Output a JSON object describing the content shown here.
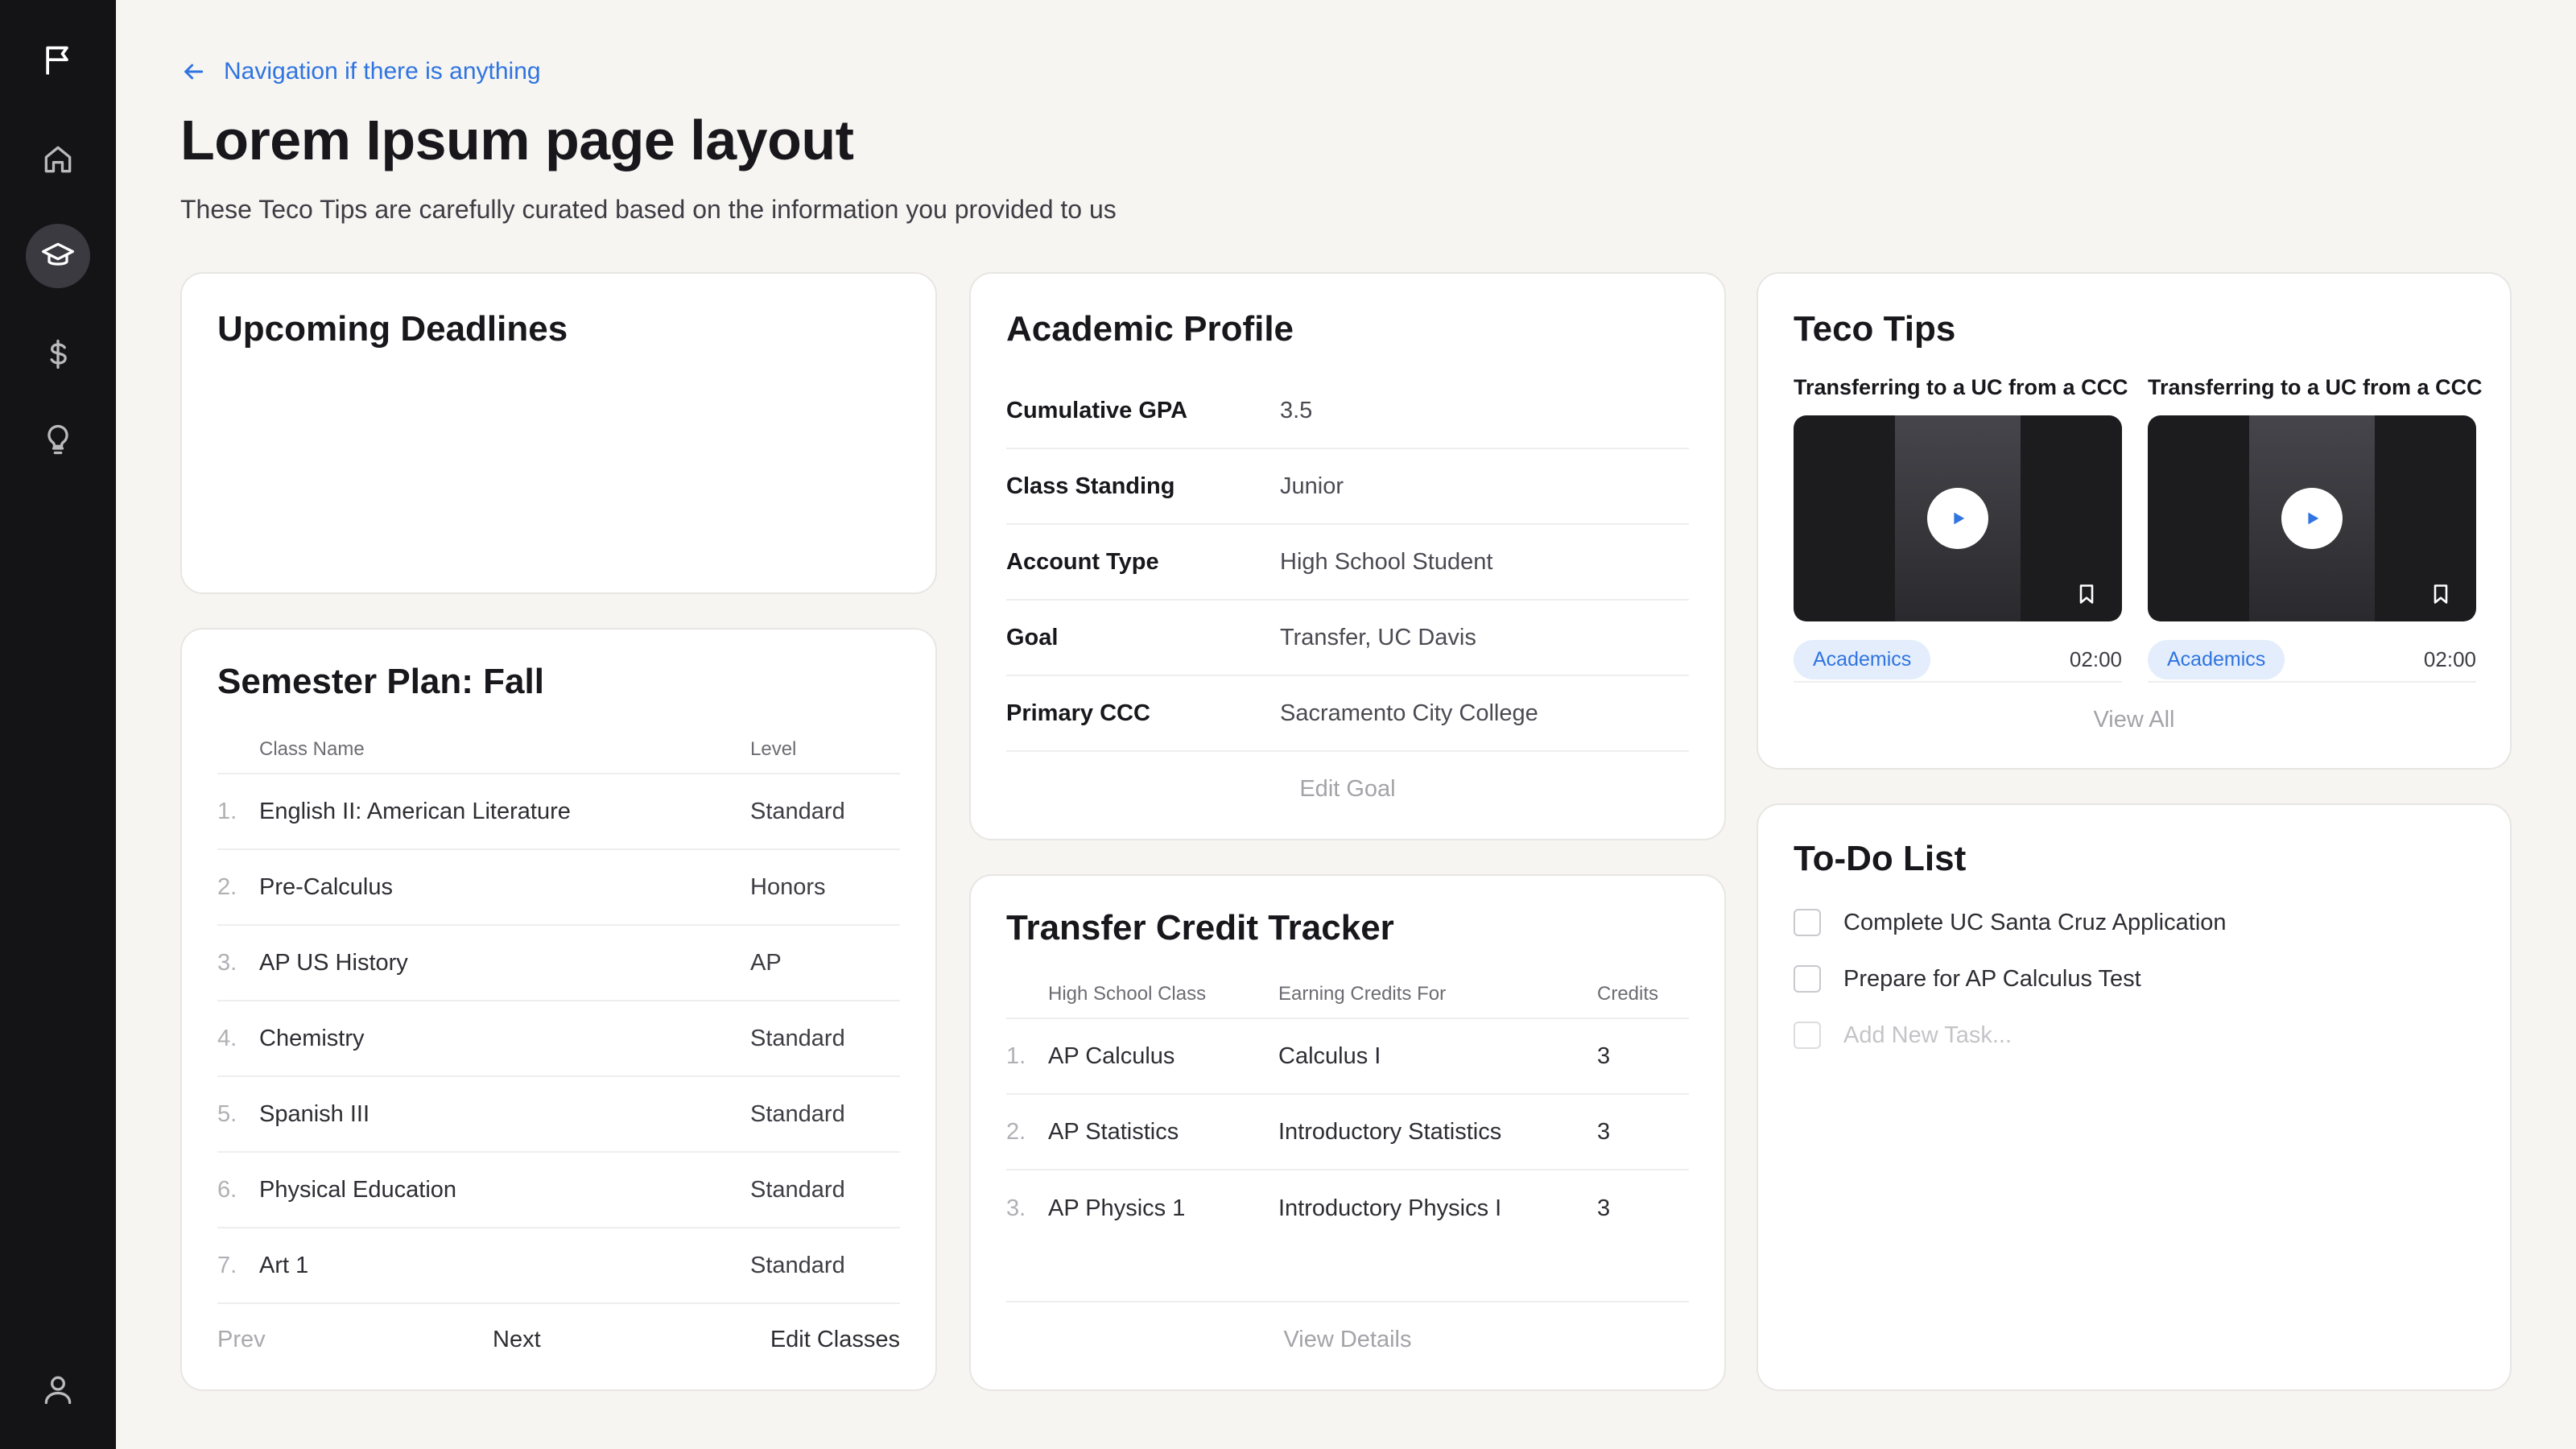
{
  "sidebar": {
    "icons": [
      "flag-icon",
      "home-icon",
      "graduation-cap-icon",
      "dollar-icon",
      "lightbulb-icon",
      "user-icon"
    ],
    "active": "graduation-cap-icon"
  },
  "header": {
    "nav_link": "Navigation if there is anything",
    "title": "Lorem Ipsum page layout",
    "subtitle": "These Teco Tips are carefully curated based on the information you provided to us"
  },
  "deadlines": {
    "title": "Upcoming Deadlines"
  },
  "semester": {
    "title": "Semester Plan: Fall",
    "col_class": "Class Name",
    "col_level": "Level",
    "rows": [
      {
        "num": "1.",
        "name": "English II: American Literature",
        "level": "Standard"
      },
      {
        "num": "2.",
        "name": "Pre-Calculus",
        "level": "Honors"
      },
      {
        "num": "3.",
        "name": "AP US History",
        "level": "AP"
      },
      {
        "num": "4.",
        "name": "Chemistry",
        "level": "Standard"
      },
      {
        "num": "5.",
        "name": "Spanish III",
        "level": "Standard"
      },
      {
        "num": "6.",
        "name": "Physical Education",
        "level": "Standard"
      },
      {
        "num": "7.",
        "name": "Art 1",
        "level": "Standard"
      }
    ],
    "prev": "Prev",
    "next": "Next",
    "edit": "Edit Classes"
  },
  "profile": {
    "title": "Academic Profile",
    "rows": [
      {
        "label": "Cumulative GPA",
        "value": "3.5"
      },
      {
        "label": "Class Standing",
        "value": "Junior"
      },
      {
        "label": "Account Type",
        "value": "High School Student"
      },
      {
        "label": "Goal",
        "value": "Transfer, UC Davis"
      },
      {
        "label": "Primary CCC",
        "value": "Sacramento City College"
      }
    ],
    "edit": "Edit Goal"
  },
  "transfer": {
    "title": "Transfer Credit Tracker",
    "col_hs": "High School Class",
    "col_for": "Earning Credits For",
    "col_credits": "Credits",
    "rows": [
      {
        "num": "1.",
        "hs": "AP Calculus",
        "for": "Calculus I",
        "credits": "3"
      },
      {
        "num": "2.",
        "hs": "AP Statistics",
        "for": "Introductory Statistics",
        "credits": "3"
      },
      {
        "num": "3.",
        "hs": "AP Physics 1",
        "for": "Introductory Physics I",
        "credits": "3"
      }
    ],
    "view": "View Details"
  },
  "tips": {
    "title": "Teco Tips",
    "items": [
      {
        "title": "Transferring to a UC from a CCC",
        "tag": "Academics",
        "duration": "02:00"
      },
      {
        "title": "Transferring to a UC from a CCC",
        "tag": "Academics",
        "duration": "02:00"
      }
    ],
    "view_all": "View All"
  },
  "todo": {
    "title": "To-Do List",
    "items": [
      "Complete UC Santa Cruz Application",
      "Prepare for AP Calculus Test"
    ],
    "placeholder": "Add New Task..."
  },
  "colors": {
    "sidebar": "#141416",
    "accent": "#2f74e0",
    "background": "#f6f5f2",
    "chip": "#e3edfb"
  }
}
